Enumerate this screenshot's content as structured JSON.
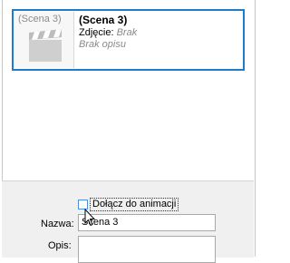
{
  "scene": {
    "thumb_label": "(Scena 3)",
    "title": "(Scena 3)",
    "photo_label": "Zdjęcie:",
    "photo_value": "Brak",
    "description": "Brak opisu",
    "selected": true
  },
  "form": {
    "include_label": "Dołącz do animacji",
    "include_checked": false,
    "name_label": "Nazwa:",
    "name_value": "Scena 3",
    "desc_label": "Opis:",
    "desc_value": ""
  },
  "colors": {
    "selection_border": "#1e7ccf",
    "panel_background": "#f0f0f0"
  },
  "icons": [
    "clapperboard-icon",
    "mouse-cursor-icon"
  ]
}
